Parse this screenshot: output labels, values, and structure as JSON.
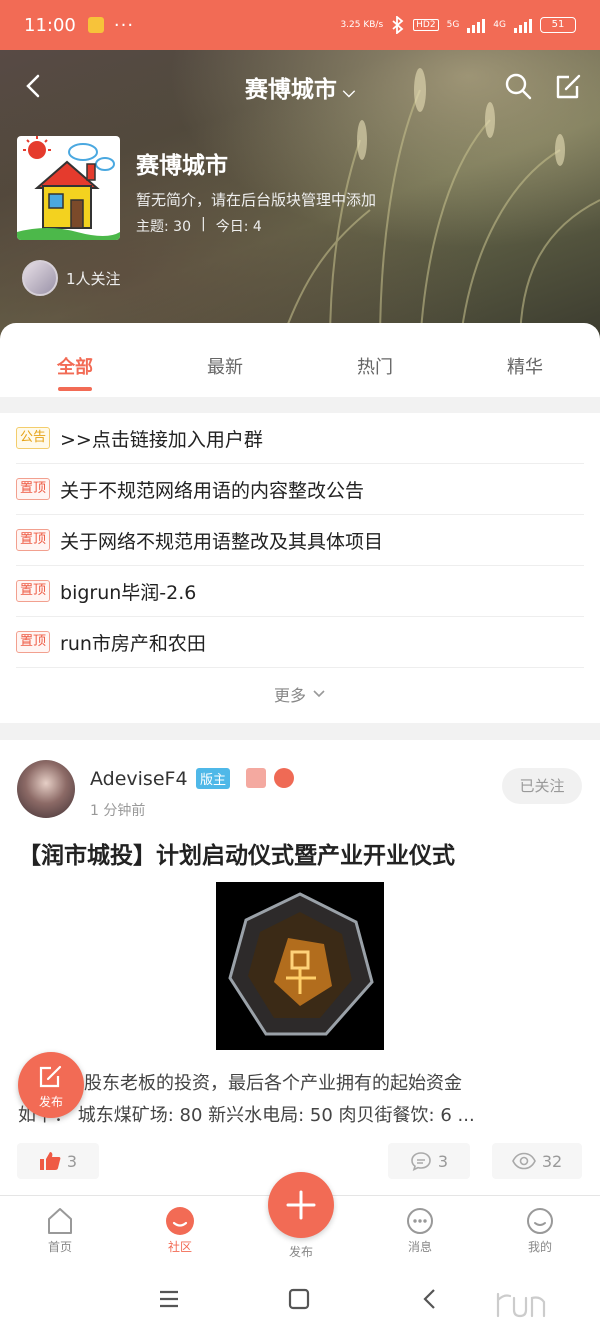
{
  "status_bar": {
    "time": "11:00",
    "dots": "···",
    "net_speed": "3.25 KB/s",
    "hd": "HD2",
    "sim1": "5G",
    "sim2": "4G",
    "battery": "51"
  },
  "header": {
    "title": "赛博城市",
    "back_icon": "back-arrow-icon",
    "search_icon": "search-icon",
    "edit_icon": "edit-icon"
  },
  "forum": {
    "name": "赛博城市",
    "intro": "暂无简介，请在后台版块管理中添加",
    "topics_label": "主题:",
    "topics": "30",
    "separator": "|",
    "today_label": "今日:",
    "today": "4",
    "followers": "1人关注"
  },
  "tabs": [
    {
      "label": "全部",
      "active": true
    },
    {
      "label": "最新",
      "active": false
    },
    {
      "label": "热门",
      "active": false
    },
    {
      "label": "精华",
      "active": false
    }
  ],
  "notices": [
    {
      "tag": "公告",
      "title": ">>点击链接加入用户群"
    },
    {
      "tag": "置顶",
      "title": "关于不规范网络用语的内容整改公告"
    },
    {
      "tag": "置顶",
      "title": "关于网络不规范用语整改及其具体项目"
    },
    {
      "tag": "置顶",
      "title": "bigrun毕润-2.6"
    },
    {
      "tag": "置顶",
      "title": "run市房产和农田"
    }
  ],
  "more_label": "更多",
  "post": {
    "author": "AdeviseF4",
    "mod_badge": "版主",
    "time": "1 分钟前",
    "follow_state": "已关注",
    "title": "【润市城投】计划启动仪式暨产业开业仪式",
    "excerpt_line1": "位股东老板的投资，最后各个产业拥有的起始资金",
    "excerpt_line2": "如下： 城东煤矿场: 80 新兴水电局: 50 肉贝街餐饮: 6 ...",
    "likes": "3",
    "comments": "3",
    "views": "32"
  },
  "fab": {
    "label": "发布"
  },
  "tabbar": [
    {
      "label": "首页",
      "icon": "home-icon"
    },
    {
      "label": "社区",
      "icon": "community-icon"
    },
    {
      "label": "发布",
      "icon": "plus-icon"
    },
    {
      "label": "消息",
      "icon": "message-icon"
    },
    {
      "label": "我的",
      "icon": "profile-icon"
    }
  ],
  "colors": {
    "accent": "#f26b55",
    "mod_badge": "#4fb8e8",
    "notice_tag": "#ee5a43",
    "announce_tag": "#e6a316"
  }
}
